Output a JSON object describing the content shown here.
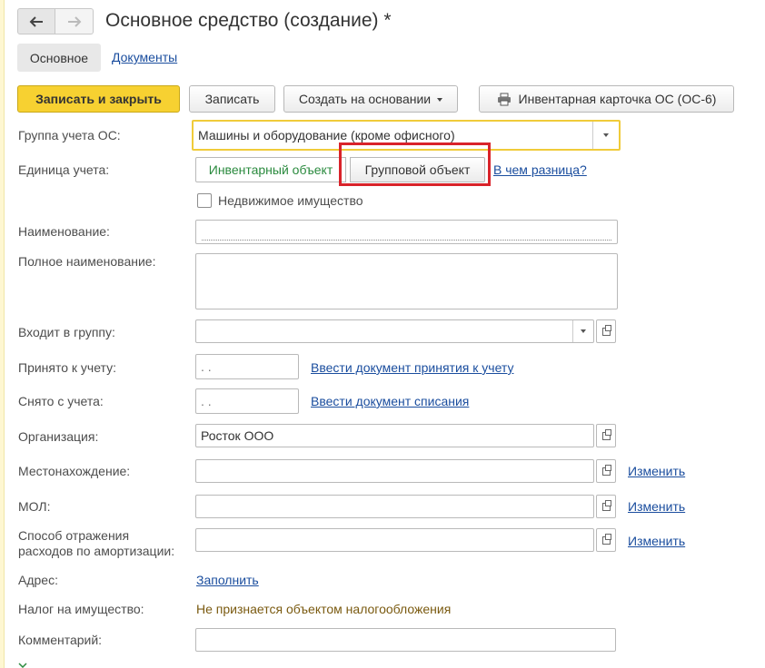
{
  "window": {
    "title": "Основное средство (создание) *"
  },
  "tabs": {
    "main": "Основное",
    "documents": "Документы"
  },
  "toolbar": {
    "save_close": "Записать и закрыть",
    "save": "Записать",
    "create_based": "Создать на основании",
    "inventory_card": "Инвентарная карточка ОС (ОС-6)"
  },
  "form": {
    "accounting_group": {
      "label": "Группа учета ОС:",
      "value": "Машины и оборудование (кроме офисного)"
    },
    "accounting_unit": {
      "label": "Единица учета:",
      "option_inventory": "Инвентарный объект",
      "option_group": "Групповой объект",
      "help_link": "В чем разница?"
    },
    "real_estate": {
      "label": "Недвижимое имущество",
      "checked": false
    },
    "name": {
      "label": "Наименование:",
      "value": ""
    },
    "full_name": {
      "label": "Полное наименование:",
      "value": ""
    },
    "parent_group": {
      "label": "Входит в группу:",
      "value": ""
    },
    "accepted": {
      "label": "Принято к учету:",
      "value": " .  .",
      "link": "Ввести документ принятия к учету"
    },
    "removed": {
      "label": "Снято с учета:",
      "value": " .  .",
      "link": "Ввести документ списания"
    },
    "organization": {
      "label": "Организация:",
      "value": "Росток ООО"
    },
    "location": {
      "label": "Местонахождение:",
      "value": "",
      "link": "Изменить"
    },
    "mol": {
      "label": "МОЛ:",
      "value": "",
      "link": "Изменить"
    },
    "depreciation": {
      "label_line1": "Способ отражения",
      "label_line2": "расходов по амортизации:",
      "value": "",
      "link": "Изменить"
    },
    "address": {
      "label": "Адрес:",
      "link": "Заполнить"
    },
    "property_tax": {
      "label": "Налог на имущество:",
      "value": "Не признается объектом налогообложения"
    },
    "comment": {
      "label": "Комментарий:",
      "value": ""
    }
  },
  "colors": {
    "accent_yellow": "#f7d131",
    "link_blue": "#1a4d9e",
    "highlight_red": "#d9232a",
    "inventory_green": "#2a8a3e",
    "tax_text": "#7a5a10"
  }
}
